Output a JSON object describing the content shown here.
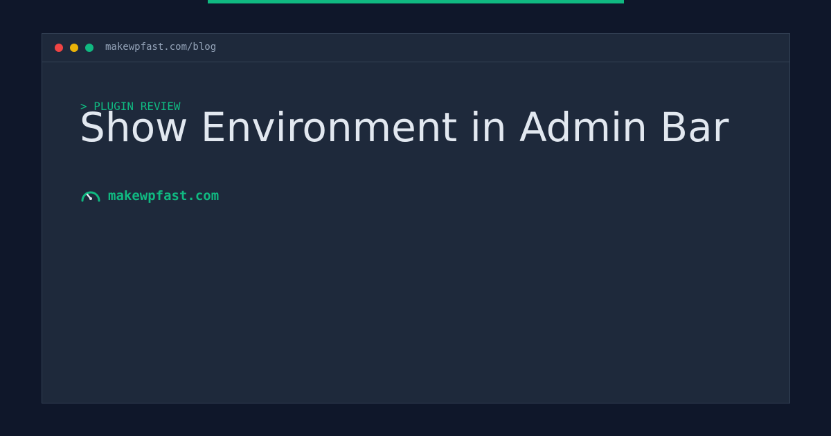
{
  "browser": {
    "url": "makewpfast.com/blog"
  },
  "post": {
    "kicker": "> PLUGIN REVIEW",
    "title": "Show Environment in Admin Bar"
  },
  "brand": {
    "icon": "speedometer-icon",
    "name": "makewpfast.com"
  },
  "colors": {
    "background": "#0f172a",
    "window": "#1e293b",
    "accent": "#10b981",
    "title_text": "#e2e8f0",
    "muted_text": "#94a3b8",
    "dot_red": "#ef4444",
    "dot_yellow": "#eab308",
    "dot_green": "#10b981"
  }
}
